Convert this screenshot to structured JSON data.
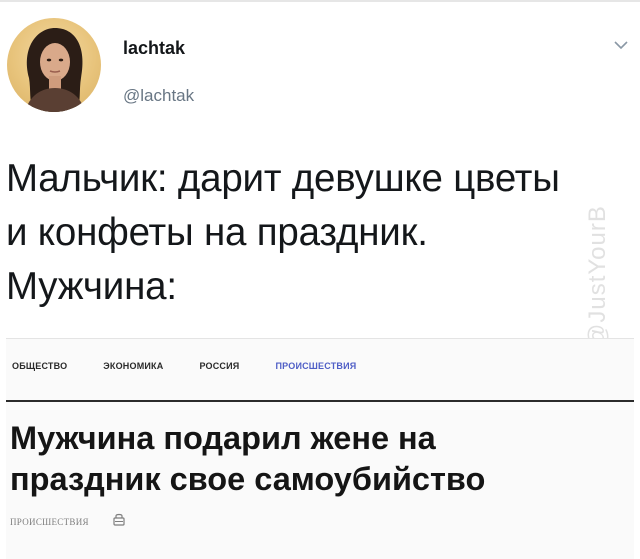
{
  "tweet": {
    "author_name": "lachtak",
    "author_handle": "@lachtak",
    "lines": [
      "Мальчик: дарит девушке цветы",
      "и конфеты на праздник.",
      "Мужчина:"
    ]
  },
  "watermark": {
    "text": "@JustYourB"
  },
  "news_card": {
    "categories": [
      "ОБЩЕСТВО",
      "ЭКОНОМИКА",
      "РОССИЯ",
      "ПРОИСШЕСТВИЯ"
    ],
    "active_category": "ПРОИСШЕСТВИЯ",
    "headline_lines": [
      "Мужчина подарил жене на",
      "праздник свое самоубийство"
    ],
    "section_label": "ПРОИСШЕСТВИЯ"
  },
  "icons": {
    "menu": "chevron-down-icon",
    "avatar": "avatar-portrait",
    "section": "lock-icon"
  },
  "colors": {
    "text_primary": "#14171a",
    "text_secondary": "#687684",
    "category_active": "#4f5ec6",
    "avatar_bg": "#e8c47c"
  }
}
